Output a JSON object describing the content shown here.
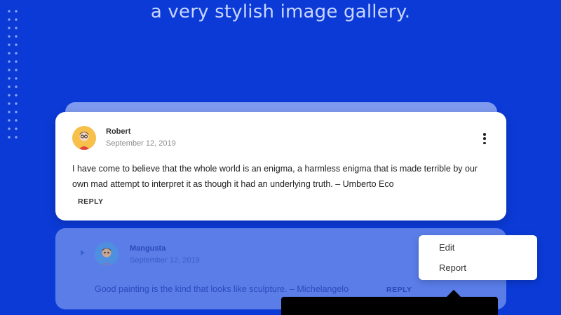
{
  "header": {
    "title": "a very stylish image gallery."
  },
  "comments": [
    {
      "author": "Robert",
      "date": "September 12, 2019",
      "text": "I have come to believe that the whole world is an enigma, a harmless enigma that is made terrible by our own mad attempt to interpret it as though it had an underlying truth. – Umberto Eco",
      "reply_label": "REPLY",
      "avatar_icon": "robert-avatar-icon"
    },
    {
      "author": "Mangusta",
      "date": "September 12, 2019",
      "text": "Good painting is the kind that looks like sculpture. – Michelangelo",
      "reply_label": "REPLY",
      "avatar_icon": "mangusta-avatar-icon"
    }
  ],
  "context_menu": {
    "items": [
      "Edit",
      "Report"
    ]
  },
  "colors": {
    "background": "#0b3ad6",
    "card": "#ffffff",
    "card_faded": "#5a7de8",
    "headline": "#c9d6ff"
  }
}
